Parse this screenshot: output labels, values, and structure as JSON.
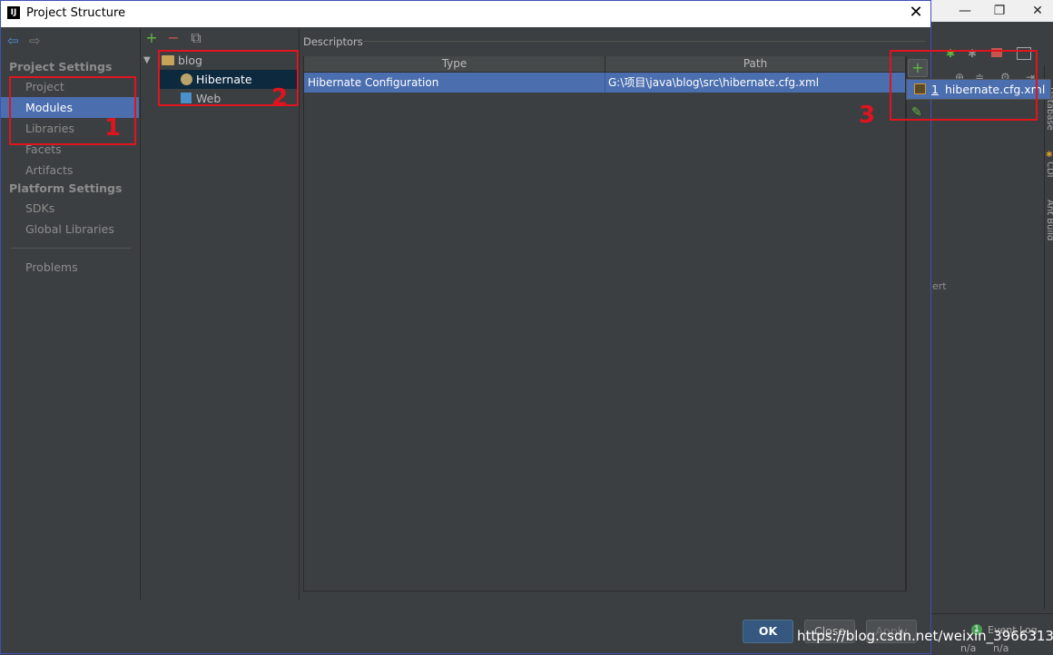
{
  "background_ide": {
    "window_controls": [
      "—",
      "❐",
      "✕"
    ],
    "right_strip_labels": [
      "Database",
      "CDI",
      "Ant Build"
    ],
    "partial_text": "ert",
    "event_log": "Event Log",
    "event_log_count": "1",
    "status": [
      "n/a",
      "n/a"
    ]
  },
  "dialog": {
    "title": "Project Structure",
    "close": "✕"
  },
  "nav": {
    "back": "⇦",
    "forward": "⇨",
    "project_settings_header": "Project Settings",
    "project_settings_items": [
      "Project",
      "Modules",
      "Libraries",
      "Facets",
      "Artifacts"
    ],
    "platform_settings_header": "Platform Settings",
    "platform_settings_items": [
      "SDKs",
      "Global Libraries"
    ],
    "problems": "Problems",
    "selected": "Modules"
  },
  "tree": {
    "toolbar": {
      "add": "+",
      "remove": "−",
      "copy": "⧉"
    },
    "root": "blog",
    "children": [
      "Hibernate",
      "Web"
    ],
    "selected": "Hibernate"
  },
  "descriptors": {
    "label": "Descriptors",
    "columns": [
      "Type",
      "Path"
    ],
    "rows": [
      {
        "type": "Hibernate Configuration",
        "path": "G:\\项目\\java\\blog\\src\\hibernate.cfg.xml"
      }
    ],
    "side_toolbar": {
      "add": "+",
      "edit": "✎"
    }
  },
  "popup": {
    "index": "1",
    "item": "hibernate.cfg.xml"
  },
  "annotations": [
    "1",
    "2",
    "3"
  ],
  "buttons": {
    "ok": "OK",
    "close": "Close",
    "apply": "Apply"
  },
  "watermark": "https://blog.csdn.net/weixin_39663138",
  "colors": {
    "selection": "#4b6eaf",
    "annotation": "#e0141e",
    "panel": "#3c3f41"
  }
}
